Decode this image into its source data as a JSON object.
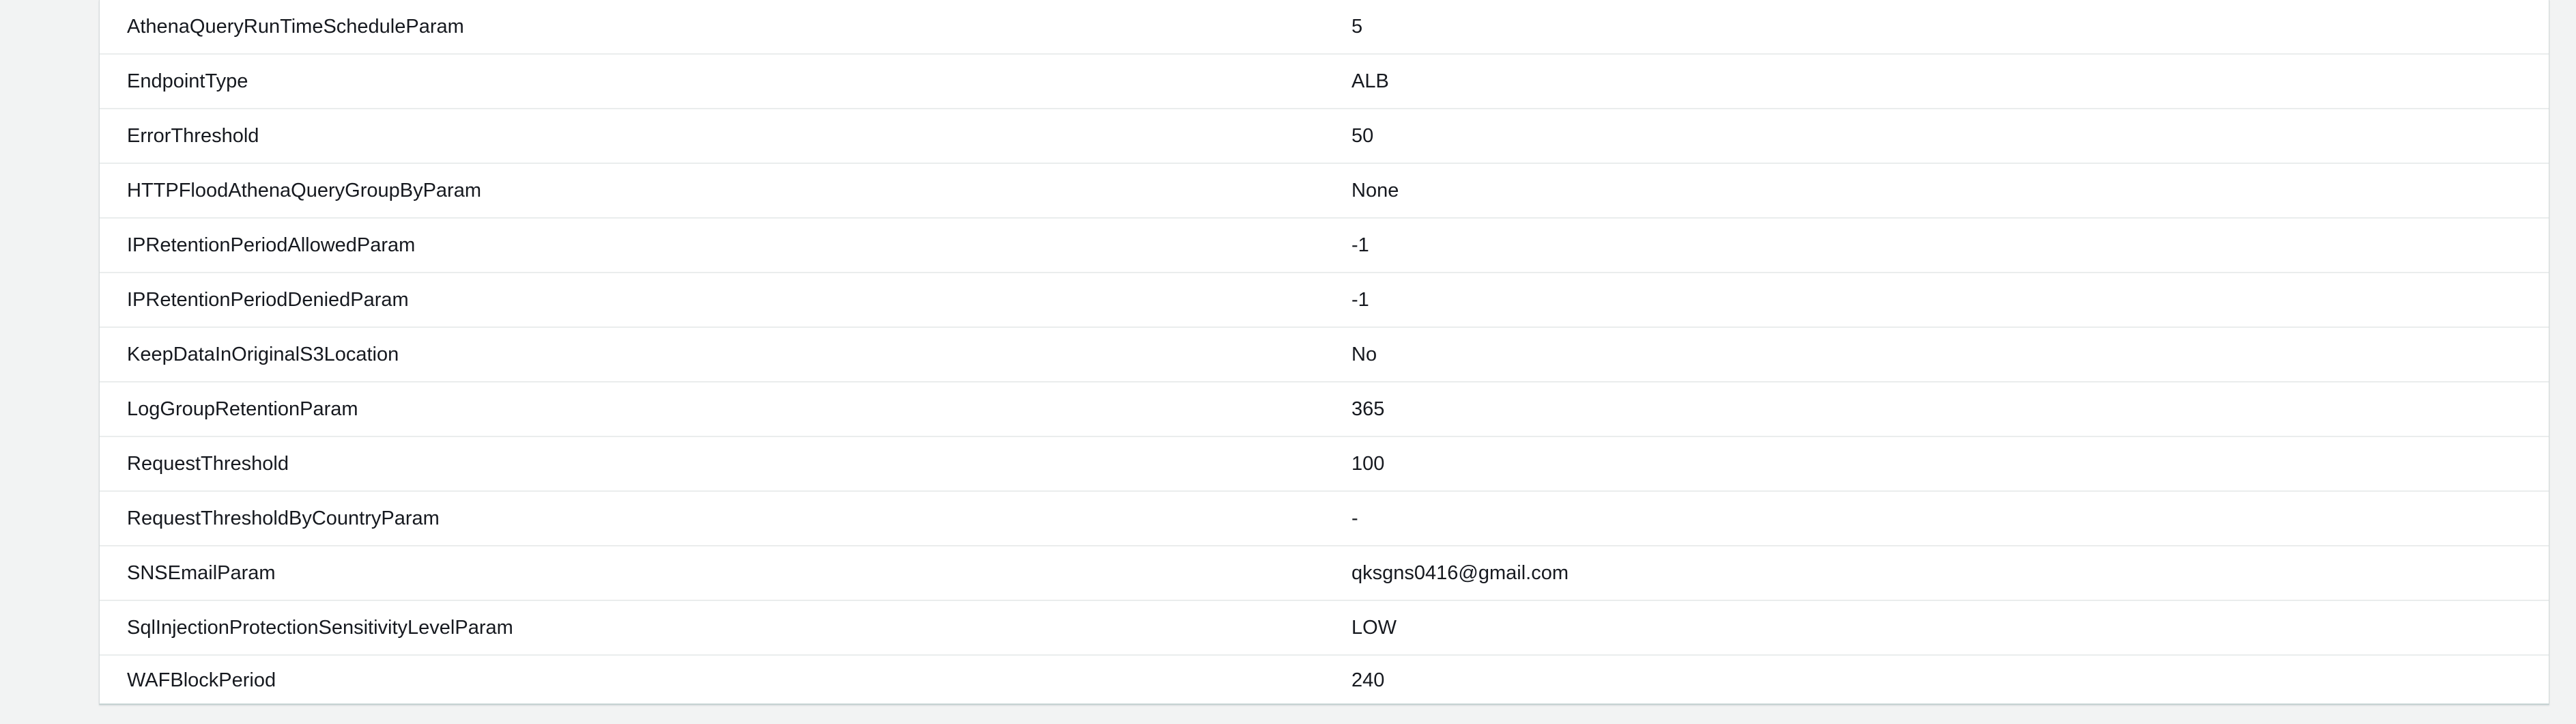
{
  "parameters": {
    "rows": [
      {
        "key": "AthenaQueryRunTimeScheduleParam",
        "value": "5"
      },
      {
        "key": "EndpointType",
        "value": "ALB"
      },
      {
        "key": "ErrorThreshold",
        "value": "50"
      },
      {
        "key": "HTTPFloodAthenaQueryGroupByParam",
        "value": "None"
      },
      {
        "key": "IPRetentionPeriodAllowedParam",
        "value": "-1"
      },
      {
        "key": "IPRetentionPeriodDeniedParam",
        "value": "-1"
      },
      {
        "key": "KeepDataInOriginalS3Location",
        "value": "No"
      },
      {
        "key": "LogGroupRetentionParam",
        "value": "365"
      },
      {
        "key": "RequestThreshold",
        "value": "100"
      },
      {
        "key": "RequestThresholdByCountryParam",
        "value": "-"
      },
      {
        "key": "SNSEmailParam",
        "value": "qksgns0416@gmail.com"
      },
      {
        "key": "SqlInjectionProtectionSensitivityLevelParam",
        "value": "LOW"
      },
      {
        "key": "WAFBlockPeriod",
        "value": "240"
      }
    ]
  }
}
